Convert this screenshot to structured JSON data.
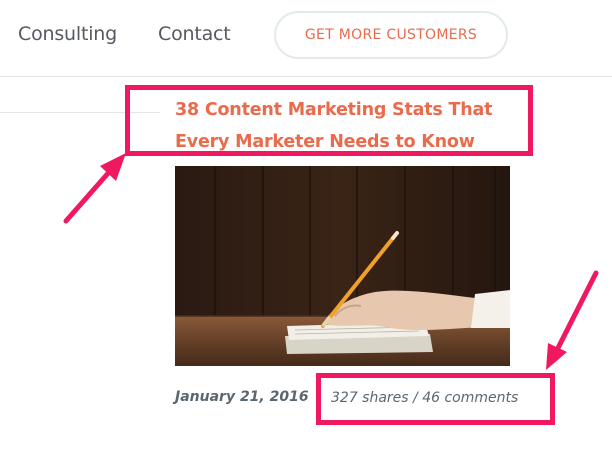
{
  "nav": {
    "links": [
      "Consulting",
      "Contact"
    ],
    "cta_label": "GET MORE CUSTOMERS"
  },
  "post": {
    "title": "38 Content Marketing Stats That Every Marketer Needs to Know",
    "date": "January 21, 2016",
    "stats": "327 shares / 46 comments",
    "image_icon": "hand-writing-with-pencil-image"
  },
  "colors": {
    "accent": "#ea6a4c",
    "highlight": "#f0185f",
    "meta_text": "#5b6770"
  }
}
